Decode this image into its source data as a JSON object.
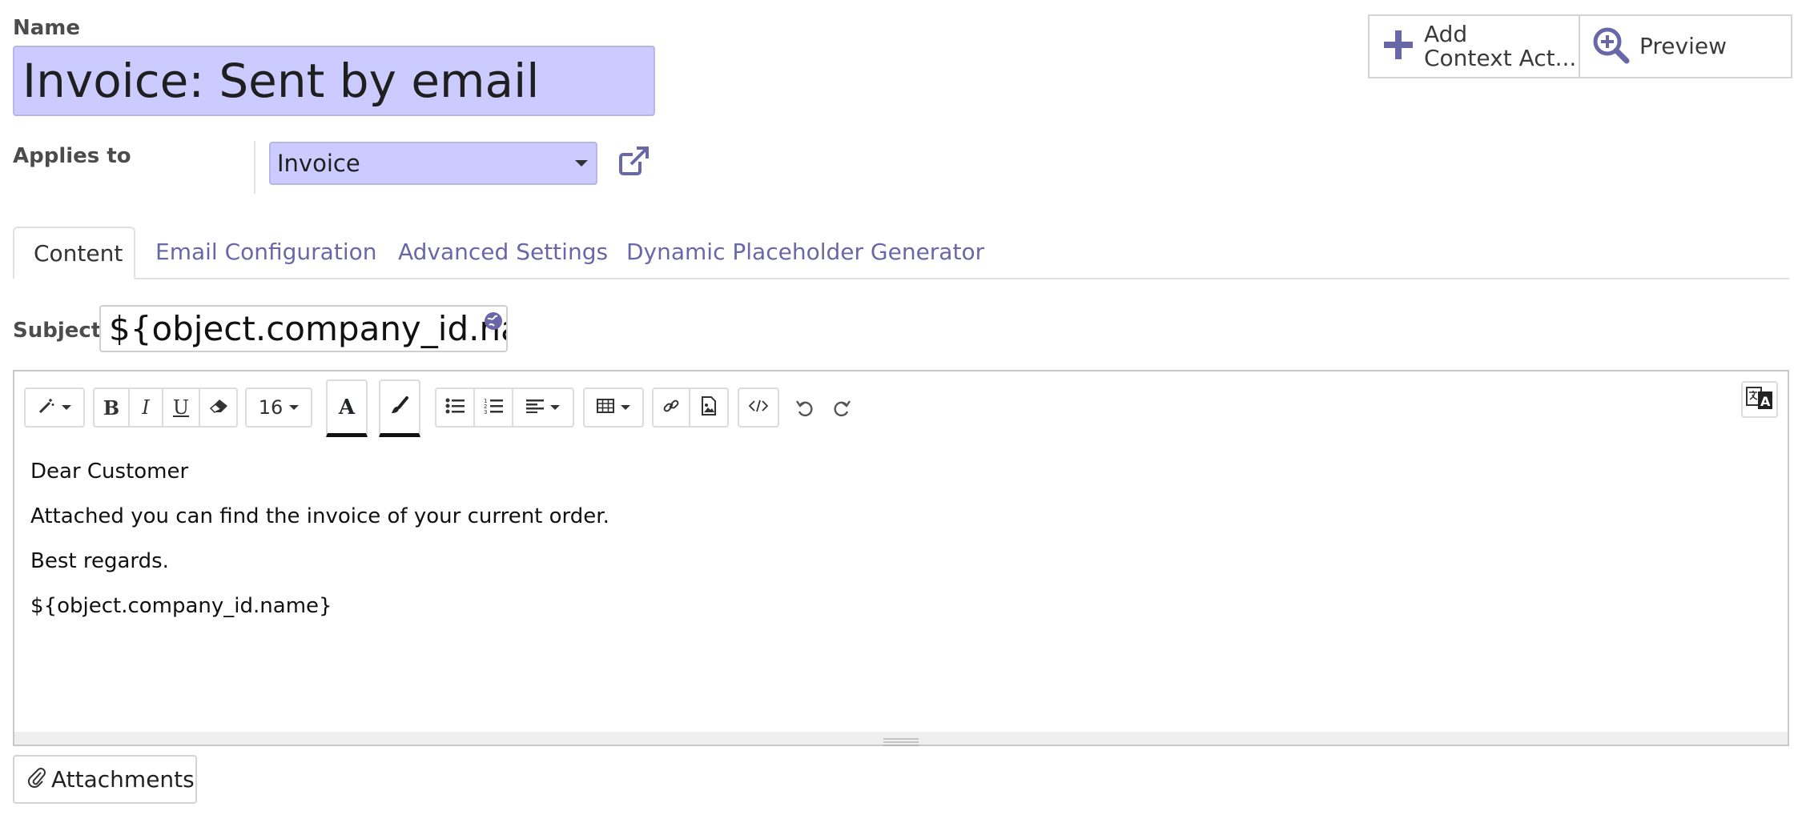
{
  "colors": {
    "field_bg": "#cccbff",
    "accent": "#6a67a9",
    "tab_text": "#6a67a9",
    "text": "#212529"
  },
  "form": {
    "name_label": "Name",
    "name_value": "Invoice: Sent by email",
    "applies_label": "Applies to",
    "applies_value": "Invoice",
    "subject_label": "Subject",
    "subject_value": "${object.company_id.name}"
  },
  "buttons": {
    "add_context_line1": "Add",
    "add_context_line2": "Context Act...",
    "preview": "Preview",
    "attachments": "Attachments"
  },
  "tabs": [
    {
      "label": "Content",
      "active": true
    },
    {
      "label": "Email Configuration",
      "active": false
    },
    {
      "label": "Advanced Settings",
      "active": false
    },
    {
      "label": "Dynamic Placeholder Generator",
      "active": false
    }
  ],
  "editor": {
    "font_size": "16",
    "toolbar_icons": [
      "magic-wand-icon",
      "bold-icon",
      "italic-icon",
      "underline-icon",
      "eraser-icon",
      "text-color-icon",
      "paint-brush-icon",
      "bullet-list-icon",
      "numbered-list-icon",
      "align-icon",
      "table-icon",
      "link-icon",
      "image-icon",
      "code-view-icon",
      "undo-icon",
      "redo-icon",
      "translate-icon"
    ],
    "body": [
      "Dear Customer",
      "Attached you can find the invoice of your current order.",
      "Best regards.",
      "${object.company_id.name}"
    ]
  }
}
